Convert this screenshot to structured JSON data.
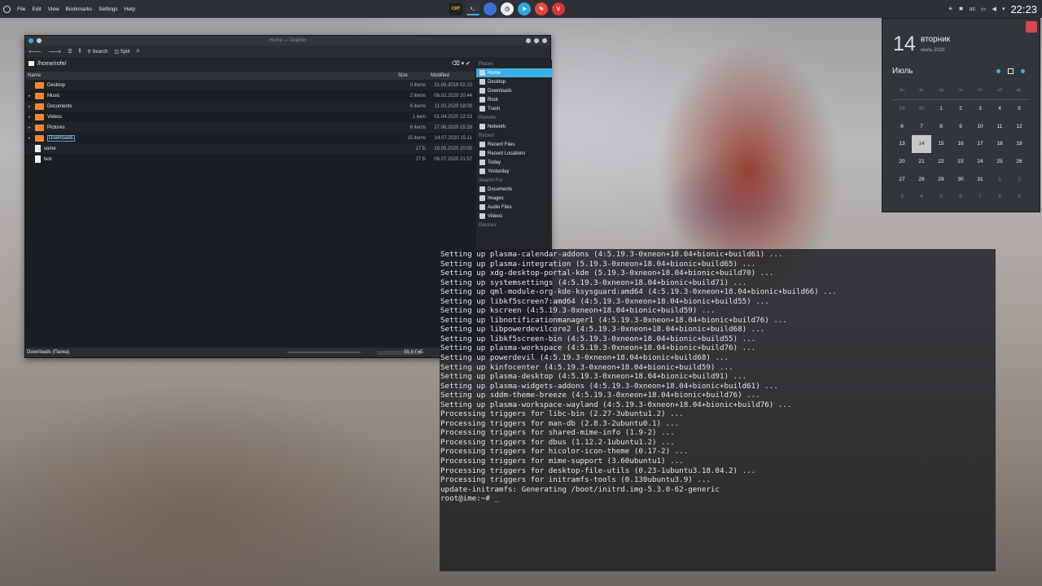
{
  "panel": {
    "menus": [
      "File",
      "Edit",
      "View",
      "Bookmarks",
      "Settings",
      "Help"
    ],
    "launcher_label": "CRT",
    "tray": {
      "layout": "us",
      "clock": "22:23"
    }
  },
  "dolphin": {
    "title": "Home — Dolphin",
    "toolbar": {
      "search": "Search",
      "split": "Split"
    },
    "path": "/home/rofe/",
    "columns": {
      "name": "Name",
      "size": "Size",
      "modified": "Modified"
    },
    "rows": [
      {
        "name": "Desktop",
        "size": "0 items",
        "modified": "21.08.2019 02:10",
        "type": "folder",
        "expand": ""
      },
      {
        "name": "Music",
        "size": "2 items",
        "modified": "06.02.2020 20:44",
        "type": "folder",
        "expand": "▸"
      },
      {
        "name": "Documents",
        "size": "6 items",
        "modified": "11.02.2020 18:09",
        "type": "folder",
        "expand": "▸"
      },
      {
        "name": "Videos",
        "size": "1 item",
        "modified": "01.04.2020 22:13",
        "type": "folder",
        "expand": "▸"
      },
      {
        "name": "Pictures",
        "size": "6 items",
        "modified": "27.06.2020 15:26",
        "type": "folder",
        "expand": "▸"
      },
      {
        "name": "Downloads",
        "size": "15 items",
        "modified": "14.07.2020 15:11",
        "type": "folder",
        "expand": "▸"
      },
      {
        "name": "some",
        "size": "17 Б",
        "modified": "18.05.2020 20:00",
        "type": "file",
        "expand": ""
      },
      {
        "name": "test",
        "size": "27 Б",
        "modified": "06.07.2020 21:57",
        "type": "file",
        "expand": ""
      }
    ],
    "places": {
      "places_label": "Places",
      "places": [
        "Home",
        "Desktop",
        "Downloads",
        "Root",
        "Trash"
      ],
      "remote_label": "Remote",
      "remote": [
        "Network"
      ],
      "recent_label": "Recent",
      "recent": [
        "Recent Files",
        "Recent Locations",
        "Today",
        "Yesterday"
      ],
      "search_label": "Search For",
      "search": [
        "Documents",
        "Images",
        "Audio Files",
        "Videos"
      ],
      "devices_label": "Devices"
    },
    "status_text": "Downloads (Папка)",
    "free_space": "55,9 ГиБ"
  },
  "terminal": {
    "lines": [
      "Setting up plasma-calendar-addons (4:5.19.3-0xneon+18.04+bionic+build61) ...",
      "Setting up plasma-integration (5.19.3-0xneon+18.04+bionic+build65) ...",
      "Setting up xdg-desktop-portal-kde (5.19.3-0xneon+18.04+bionic+build70) ...",
      "Setting up systemsettings (4:5.19.3-0xneon+18.04+bionic+build71) ...",
      "Setting up qml-module-org-kde-ksysguard:amd64 (4:5.19.3-0xneon+18.04+bionic+build66) ...",
      "Setting up libkf5screen7:amd64 (4:5.19.3-0xneon+18.04+bionic+build55) ...",
      "Setting up kscreen (4:5.19.3-0xneon+18.04+bionic+build59) ...",
      "Setting up libnotificationmanager1 (4:5.19.3-0xneon+18.04+bionic+build76) ...",
      "Setting up libpowerdevilcore2 (4:5.19.3-0xneon+18.04+bionic+build68) ...",
      "Setting up libkf5screen-bin (4:5.19.3-0xneon+18.04+bionic+build55) ...",
      "Setting up plasma-workspace (4:5.19.3-0xneon+18.04+bionic+build76) ...",
      "Setting up powerdevil (4:5.19.3-0xneon+18.04+bionic+build68) ...",
      "Setting up kinfocenter (4:5.19.3-0xneon+18.04+bionic+build59) ...",
      "Setting up plasma-desktop (4:5.19.3-0xneon+18.04+bionic+build91) ...",
      "Setting up plasma-widgets-addons (4:5.19.3-0xneon+18.04+bionic+build61) ...",
      "Setting up sddm-theme-breeze (4:5.19.3-0xneon+18.04+bionic+build76) ...",
      "Setting up plasma-workspace-wayland (4:5.19.3-0xneon+18.04+bionic+build76) ...",
      "Processing triggers for libc-bin (2.27-3ubuntu1.2) ...",
      "Processing triggers for man-db (2.8.3-2ubuntu0.1) ...",
      "Processing triggers for shared-mime-info (1.9-2) ...",
      "Processing triggers for dbus (1.12.2-1ubuntu1.2) ...",
      "Processing triggers for hicolor-icon-theme (0.17-2) ...",
      "Processing triggers for mime-support (3.60ubuntu1) ...",
      "Processing triggers for desktop-file-utils (0.23-1ubuntu3.18.04.2) ...",
      "Processing triggers for initramfs-tools (0.130ubuntu3.9) ...",
      "update-initramfs: Generating /boot/initrd.img-5.3.0-62-generic",
      "root@ime:~# _"
    ]
  },
  "calendar": {
    "day": "14",
    "weekday": "вторник",
    "month_year": "июль 2020",
    "month": "Июль",
    "headers": [
      "пн",
      "вт",
      "ср",
      "чт",
      "пт",
      "сб",
      "вс"
    ],
    "weeks": [
      [
        {
          "d": "29",
          "o": true
        },
        {
          "d": "30",
          "o": true
        },
        {
          "d": "1"
        },
        {
          "d": "2"
        },
        {
          "d": "3"
        },
        {
          "d": "4"
        },
        {
          "d": "5"
        }
      ],
      [
        {
          "d": "6"
        },
        {
          "d": "7"
        },
        {
          "d": "8"
        },
        {
          "d": "9"
        },
        {
          "d": "10"
        },
        {
          "d": "11"
        },
        {
          "d": "12"
        }
      ],
      [
        {
          "d": "13"
        },
        {
          "d": "14",
          "t": true
        },
        {
          "d": "15"
        },
        {
          "d": "16"
        },
        {
          "d": "17"
        },
        {
          "d": "18"
        },
        {
          "d": "19"
        }
      ],
      [
        {
          "d": "20"
        },
        {
          "d": "21"
        },
        {
          "d": "22"
        },
        {
          "d": "23"
        },
        {
          "d": "24"
        },
        {
          "d": "25"
        },
        {
          "d": "26"
        }
      ],
      [
        {
          "d": "27"
        },
        {
          "d": "28"
        },
        {
          "d": "29"
        },
        {
          "d": "30"
        },
        {
          "d": "31"
        },
        {
          "d": "1",
          "o": true
        },
        {
          "d": "2",
          "o": true
        }
      ],
      [
        {
          "d": "3",
          "o": true
        },
        {
          "d": "4",
          "o": true
        },
        {
          "d": "5",
          "o": true
        },
        {
          "d": "6",
          "o": true
        },
        {
          "d": "7",
          "o": true
        },
        {
          "d": "8",
          "o": true
        },
        {
          "d": "9",
          "o": true
        }
      ]
    ]
  }
}
